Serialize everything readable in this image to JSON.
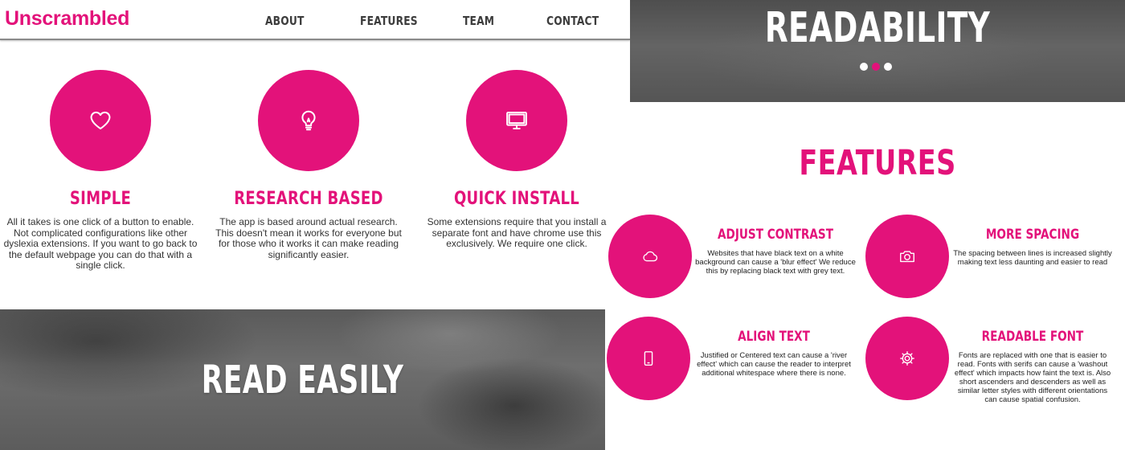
{
  "nav": {
    "logo": "Unscrambled",
    "links": [
      "ABOUT",
      "FEATURES",
      "TEAM",
      "CONTACT"
    ]
  },
  "columns": [
    {
      "icon": "heart-icon",
      "title": "SIMPLE",
      "text": "All it takes is one click of a button to enable. Not complicated configurations like other dyslexia extensions. If you want to go back to the default webpage you can do that with a single click."
    },
    {
      "icon": "lightbulb-icon",
      "title": "RESEARCH BASED",
      "text": "The app is based around actual research. This doesn't mean it works for everyone but for those who it works it can make reading significantly easier."
    },
    {
      "icon": "monitor-icon",
      "title": "QUICK INSTALL",
      "text": "Some extensions require that you install a separate font and have chrome use this exclusively. We require one click."
    }
  ],
  "read_easily": {
    "title": "READ EASILY"
  },
  "readability": {
    "title": "READABILITY",
    "slides_total": 3,
    "active_slide": 2
  },
  "features": {
    "title": "FEATURES",
    "items": [
      {
        "icon": "cloud-icon",
        "title": "ADJUST CONTRAST",
        "text": "Websites that have black text on a white background can cause a 'blur effect' We reduce this by replacing black text with grey text."
      },
      {
        "icon": "camera-icon",
        "title": "MORE SPACING",
        "text": "The spacing between lines is increased slightly making text less daunting and easier to read"
      },
      {
        "icon": "tablet-icon",
        "title": "ALIGN TEXT",
        "text": "Justified or Centered text can cause a 'river effect' which can cause the reader to interpret additional whitespace where there is none."
      },
      {
        "icon": "gear-icon",
        "title": "READABLE FONT",
        "text": "Fonts are replaced with one that is easier to read. Fonts with serifs can cause a 'washout effect' which impacts how faint the text is. Also short ascenders and descenders as well as similar letter styles with different orientations can cause spatial confusion."
      }
    ]
  },
  "colors": {
    "accent": "#e3127a",
    "nav_text": "#3d3d3d",
    "banner_gray": "#5f5f5f"
  }
}
